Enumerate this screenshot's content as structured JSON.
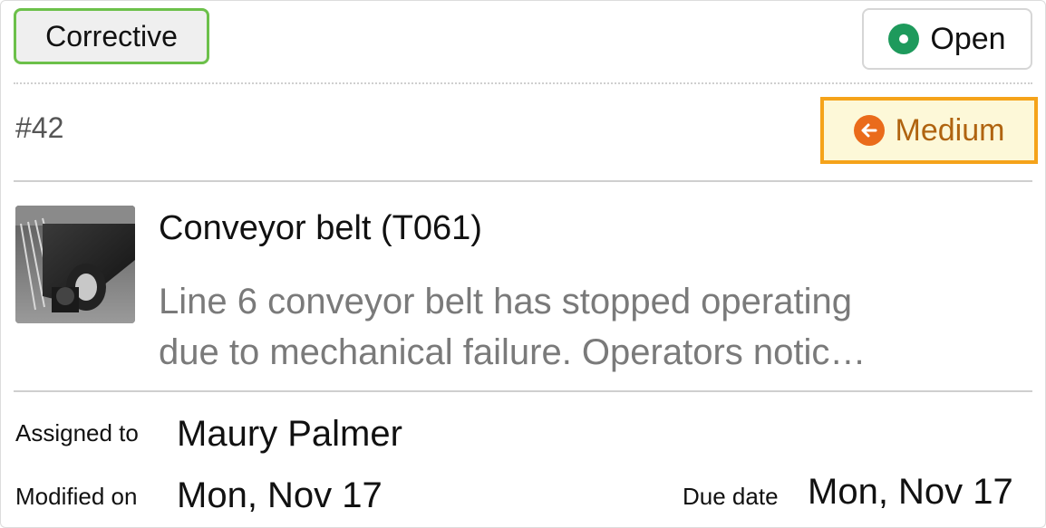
{
  "header": {
    "type_label": "Corrective",
    "status_label": "Open",
    "status_color": "#1e9a5c"
  },
  "meta": {
    "work_id": "#42",
    "priority_label": "Medium",
    "priority_icon": "arrow-left-circle-icon",
    "priority_color": "#ea6b1b"
  },
  "asset": {
    "thumbnail_icon": "conveyor-belt-photo",
    "title": "Conveyor belt (T061)",
    "description_lines": [
      "Line 6 conveyor belt has stopped operating",
      "due to mechanical failure. Operators notic…"
    ]
  },
  "details": {
    "assigned_label": "Assigned to",
    "assigned_value": "Maury Palmer",
    "modified_label": "Modified on",
    "modified_value": "Mon, Nov 17",
    "due_label": "Due date",
    "due_value": "Mon, Nov 17"
  }
}
